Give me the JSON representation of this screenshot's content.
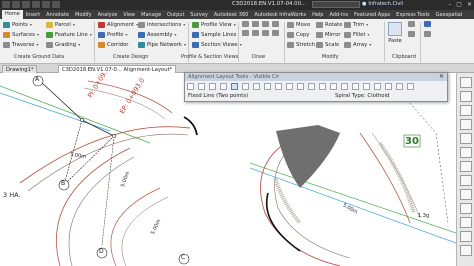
{
  "window": {
    "title": "C3D2018.EN.V1.07-04.00...",
    "search_hint": "",
    "user": "Infratech.Civil",
    "controls": [
      "–",
      "▢",
      "✕"
    ]
  },
  "tabs": [
    "Home",
    "Insert",
    "Annotate",
    "Modify",
    "Analyze",
    "View",
    "Manage",
    "Output",
    "Survey",
    "Autodesk 360",
    "Autodesk InfraWorks",
    "Help",
    "Add-ins",
    "Featured Apps",
    "Express Tools",
    "Geospatial"
  ],
  "ribbon": {
    "create_ground_data": {
      "items": [
        "Points",
        "Surfaces",
        "Traverse",
        "Parcel",
        "Feature Line",
        "Grading"
      ],
      "label": "Create Ground Data"
    },
    "create_design": {
      "items": [
        "Alignment",
        "Profile",
        "Corridor",
        "Intersections",
        "Assembly",
        "Pipe Network"
      ],
      "label": "Create Design"
    },
    "profile_section_views": {
      "items": [
        "Profile View",
        "Sample Lines",
        "Section Views"
      ],
      "label": "Profile & Section Views"
    },
    "draw": {
      "label": "Draw"
    },
    "modify": {
      "items": [
        "Move",
        "Copy",
        "Stretch",
        "Rotate",
        "Mirror",
        "Scale",
        "Trim",
        "Fillet",
        "Array"
      ],
      "label": "Modify"
    },
    "clipboard": {
      "paste": "Paste",
      "label": "Clipboard"
    }
  },
  "doc_tabs": [
    "Drawing1*",
    "C3D2018.EN.V1.07-0... Alignment-Layout*"
  ],
  "alignment_tools": {
    "title": "Alignment Layout Tools - Visible Cir",
    "status_left": "Fixed Line (Two points)",
    "status_right": "Spiral Type: Clothoid",
    "close": "✕"
  },
  "drawing": {
    "label_a": "A",
    "label_b": "B",
    "label_c": "C",
    "label_d": "D",
    "pi_label": "PI: 0+093.7",
    "ep_label": "EP: 0+093.0",
    "station_30": "30",
    "area_label": "3 HA.",
    "dim_left": "5.00m",
    "dim_right": "5.00m",
    "dim_right2": "1.3g",
    "dim_vert": "5.00m",
    "dim_bottom": "5.00m"
  }
}
